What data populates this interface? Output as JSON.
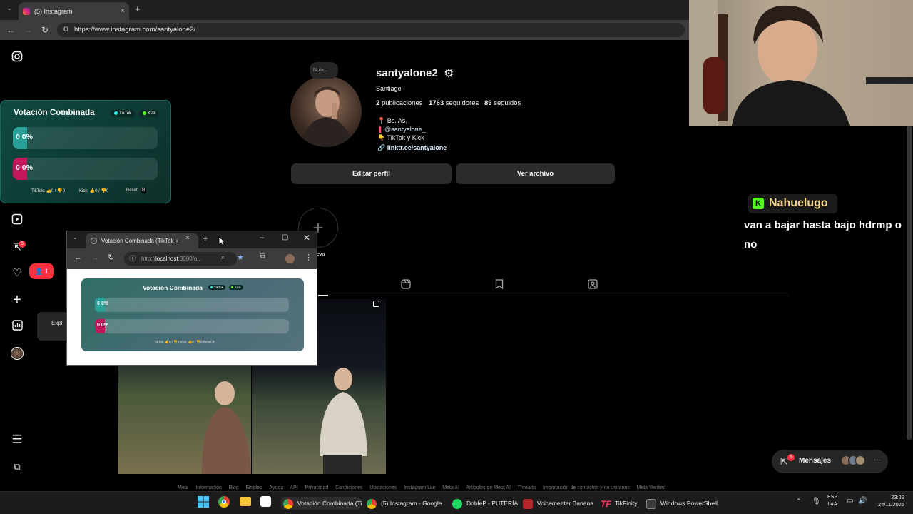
{
  "browser": {
    "tab_title": "(5) Instagram",
    "tab_close": "×",
    "new_tab": "+",
    "url": "https://www.instagram.com/santyalone2/"
  },
  "sidebar": {
    "notifications_badge": "5",
    "likes_badge": "1",
    "explore_tooltip": "Expl"
  },
  "vote_widget": {
    "title": "Votación Combinada",
    "chip_tiktok": "TikTok",
    "chip_kick": "Kick",
    "bar1": "0  0%",
    "bar2": "0  0%",
    "footer_tiktok": "TikTok: 👍0 / 👎0",
    "footer_kick": "Kick: 👍0 / 👎0",
    "footer_reset": "Reset:",
    "reset_key": "R"
  },
  "profile": {
    "note": "Nota...",
    "username": "santyalone2",
    "full_name": "Santiago",
    "posts_count": "2",
    "posts_label": "publicaciones",
    "followers_count": "1763",
    "followers_label": "seguidores",
    "following_count": "89",
    "following_label": "seguidos",
    "bio_location": "📍 Bs. As.",
    "bio_mention": "@santyalone_",
    "bio_line3": "👇 TikTok y Kick",
    "bio_link": "linktr.ee/santyalone",
    "edit_button": "Editar perfil",
    "archive_button": "Ver archivo",
    "new_highlight": "eva"
  },
  "popup": {
    "tab_title": "Votación Combinada (TikTok +",
    "url_prefix": "http://",
    "url_host": "localhost",
    "url_rest": ":3000/o...",
    "widget_title": "Votación Combinada",
    "chip_tiktok": "TikTok",
    "chip_kick": "Kick",
    "bar1": "0  0%",
    "bar2": "0  0%",
    "footer": "TikTok: 👍0 / 👎0    Kick: 👍0 / 👎0    Reset: R"
  },
  "chat": {
    "username": "Nahuelugo",
    "message": "van a bajar hasta bajo hdrmp o no"
  },
  "messages_pill": {
    "label": "Mensajes",
    "badge": "5"
  },
  "footer_links": [
    "Meta",
    "Información",
    "Blog",
    "Empleo",
    "Ayuda",
    "API",
    "Privacidad",
    "Condiciones",
    "Ubicaciones",
    "Instagram Lite",
    "Meta AI",
    "Artículos de Meta AI",
    "Threads",
    "Importación de contactos y no usuarios",
    "Meta Verified"
  ],
  "taskbar": {
    "item1": "Votación Combinada (Ti",
    "item2": "(5) Instagram - Google",
    "item3": "DobleP - PUTERÍA",
    "item4": "Voicemeeter Banana",
    "item5": "TikFinity",
    "item6": "Windows PowerShell",
    "lang1": "ESP",
    "lang2": "LAA",
    "time": "23:29",
    "date": "24/11/2025"
  },
  "colors": {
    "instagram_bg": "#000000",
    "accent_link": "#e0f1ff",
    "kick_green": "#53fc18",
    "tiktok_chip": "#25f4ee",
    "vote_bar_pink": "#c2185b",
    "vote_bar_teal": "#2aa198"
  }
}
